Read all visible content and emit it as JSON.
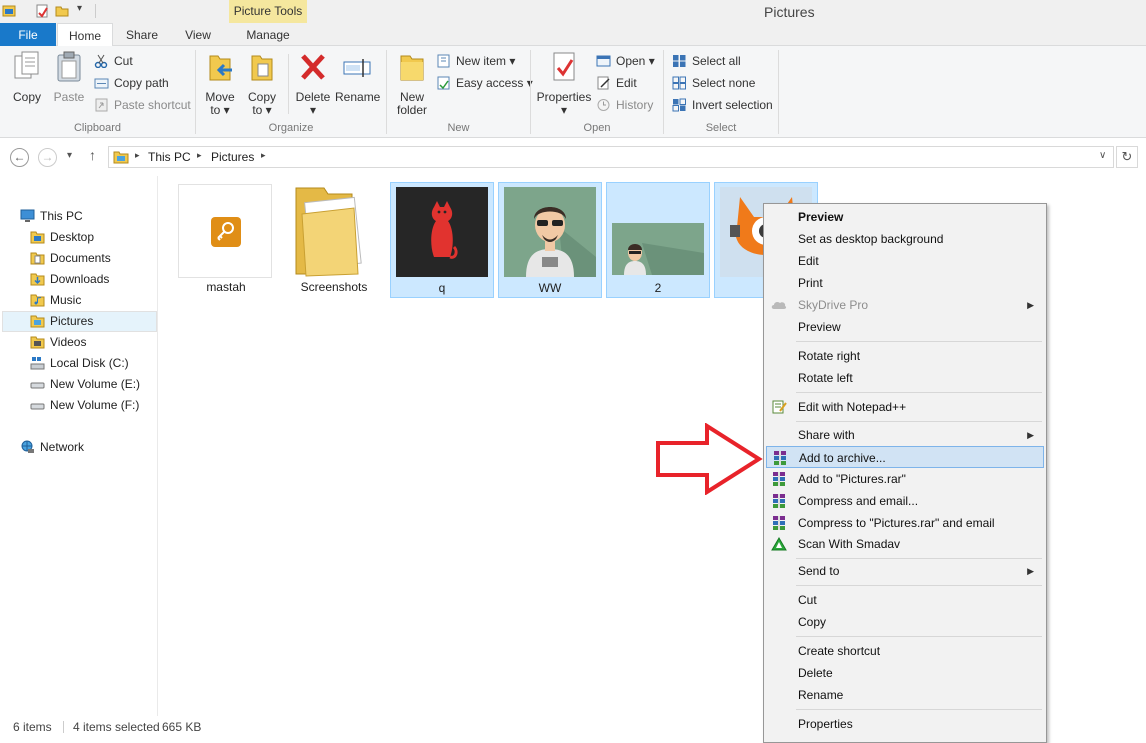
{
  "window": {
    "title": "Pictures",
    "contextual_tab_group": "Picture Tools"
  },
  "tabs": [
    "File",
    "Home",
    "Share",
    "View",
    "Manage"
  ],
  "ribbon": {
    "clipboard": {
      "label": "Clipboard",
      "copy": "Copy",
      "paste": "Paste",
      "cut": "Cut",
      "copy_path": "Copy path",
      "paste_shortcut": "Paste shortcut"
    },
    "organize": {
      "label": "Organize",
      "move_to_1": "Move",
      "move_to_2": "to",
      "copy_to_1": "Copy",
      "copy_to_2": "to",
      "delete": "Delete",
      "rename": "Rename"
    },
    "new": {
      "label": "New",
      "new_folder_1": "New",
      "new_folder_2": "folder",
      "new_item": "New item",
      "easy_access": "Easy access"
    },
    "open": {
      "label": "Open",
      "properties": "Properties",
      "open": "Open",
      "edit": "Edit",
      "history": "History"
    },
    "select": {
      "label": "Select",
      "select_all": "Select all",
      "select_none": "Select none",
      "invert_selection": "Invert selection"
    }
  },
  "breadcrumb": [
    "This PC",
    "Pictures"
  ],
  "nav": {
    "this_pc": "This PC",
    "items": [
      "Desktop",
      "Documents",
      "Downloads",
      "Music",
      "Pictures",
      "Videos",
      "Local Disk (C:)",
      "New Volume (E:)",
      "New Volume (F:)"
    ],
    "network": "Network"
  },
  "files": [
    {
      "name": "mastah",
      "selected": false
    },
    {
      "name": "Screenshots",
      "selected": false
    },
    {
      "name": "q",
      "selected": true
    },
    {
      "name": "WW",
      "selected": true
    },
    {
      "name": "2",
      "selected": true
    }
  ],
  "status": {
    "items": "6 items",
    "selected": "4 items selected",
    "size": "665 KB"
  },
  "context_menu": [
    "Preview",
    "Set as desktop background",
    "Edit",
    "Print",
    "SkyDrive Pro",
    "Preview",
    "Rotate right",
    "Rotate left",
    "Edit with Notepad++",
    "Share with",
    "Add to archive...",
    "Add to \"Pictures.rar\"",
    "Compress and email...",
    "Compress to \"Pictures.rar\" and email",
    "Scan With Smadav",
    "Send to",
    "Cut",
    "Copy",
    "Create shortcut",
    "Delete",
    "Rename",
    "Properties"
  ],
  "colors": {
    "file_tab": "#1979ca",
    "selection": "#cce8ff",
    "menu_highlight": "#d1e3f4",
    "arrow": "#e8232a",
    "contextual_tab": "#f5e79e"
  },
  "icons": [
    "pc-icon",
    "folder-icon",
    "disk-icon",
    "network-icon",
    "winrar-icon",
    "smadav-icon",
    "notepad-icon",
    "skydrive-icon"
  ]
}
